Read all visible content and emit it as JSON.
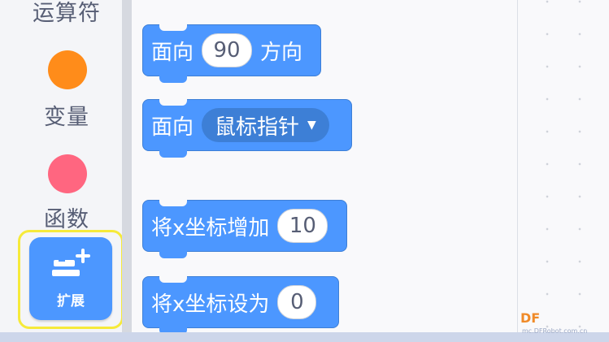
{
  "sidebar": {
    "categories": [
      {
        "label": "运算符"
      },
      {
        "label": "变量",
        "color": "#ff8c1a"
      },
      {
        "label": "函数",
        "color": "#ff6680"
      }
    ],
    "extension": {
      "label": "扩展",
      "icon": "add-extension-icon"
    }
  },
  "palette": {
    "blocks": [
      {
        "text": "面向",
        "input": "90",
        "suffix": "方向"
      },
      {
        "text": "面向",
        "dropdown": "鼠标指针"
      },
      {
        "text": "将x坐标增加",
        "input": "10"
      },
      {
        "text": "将x坐标设为",
        "input": "0"
      }
    ]
  },
  "watermark": {
    "logo": "DF",
    "sub": "mc.DFRobot.com.cn"
  },
  "colors": {
    "motion": "#4c97ff",
    "highlight": "#f6ea3a"
  }
}
